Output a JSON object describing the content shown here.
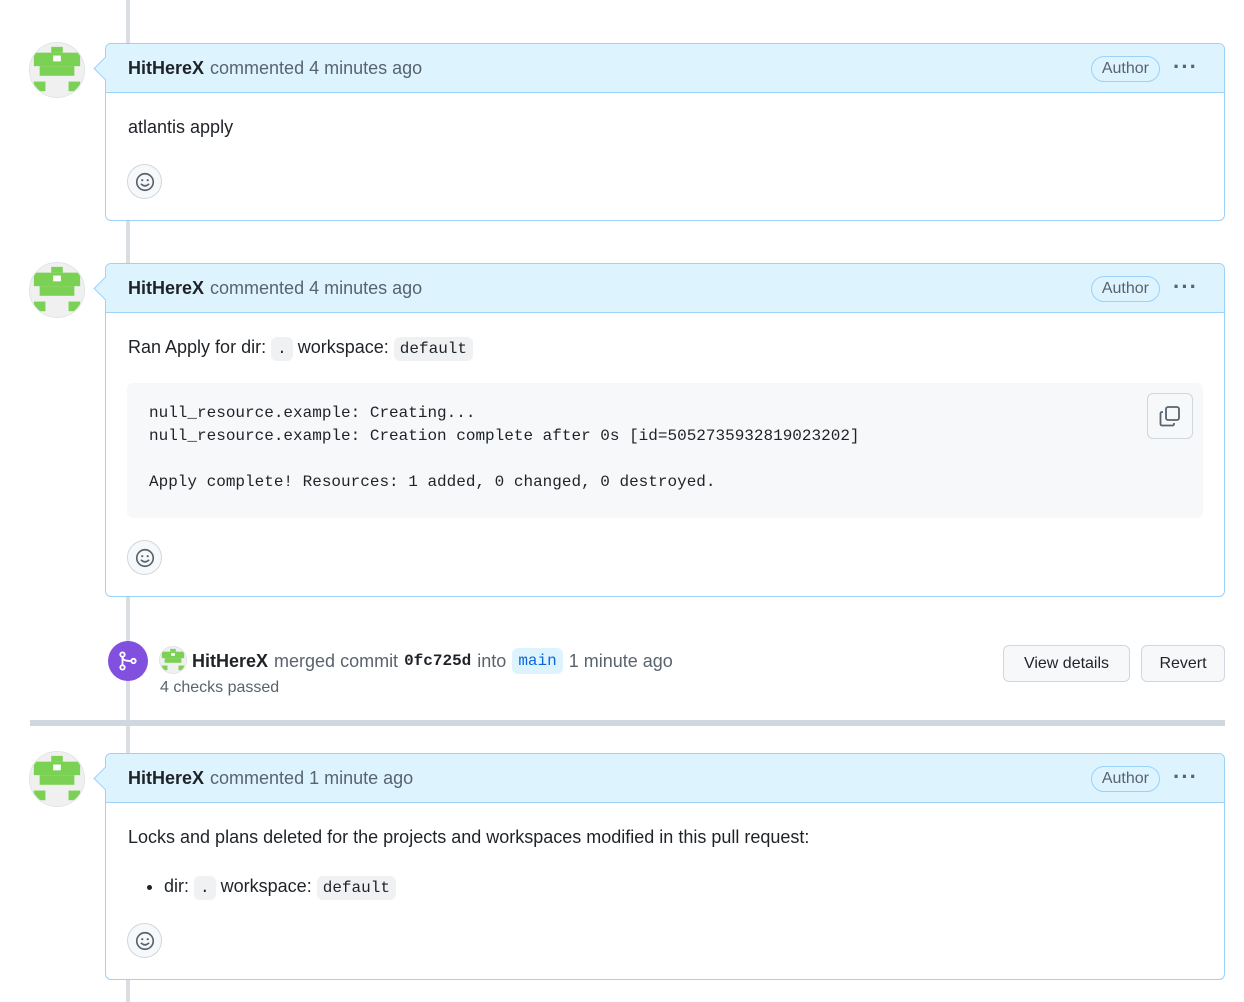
{
  "comments": [
    {
      "author": "HitHereX",
      "meta": "commented 4 minutes ago",
      "badge": "Author",
      "more": "···",
      "body": "atlantis apply"
    },
    {
      "author": "HitHereX",
      "meta": "commented 4 minutes ago",
      "badge": "Author",
      "more": "···",
      "body_prefix": "Ran Apply for dir:",
      "dir": ".",
      "body_mid": "workspace:",
      "workspace": "default",
      "code_lines": [
        "null_resource.example: Creating...",
        "null_resource.example: Creation complete after 0s [id=5052735932819023202]",
        "",
        "Apply complete! Resources: 1 added, 0 changed, 0 destroyed."
      ]
    },
    {
      "author": "HitHereX",
      "meta": "commented 1 minute ago",
      "badge": "Author",
      "more": "···",
      "body": "Locks and plans deleted for the projects and workspaces modified in this pull request:",
      "item_prefix": "dir:",
      "item_dir": ".",
      "item_mid": "workspace:",
      "item_workspace": "default"
    }
  ],
  "merge_event": {
    "author": "HitHereX",
    "action": "merged commit",
    "sha": "0fc725d",
    "into": "into",
    "branch": "main",
    "time": "1 minute ago",
    "checks": "4 checks passed",
    "view_details_label": "View details",
    "revert_label": "Revert"
  },
  "colors": {
    "header_bg": "#ddf4ff",
    "merge_purple": "#8250df",
    "avatar_green": "#7ad153"
  }
}
